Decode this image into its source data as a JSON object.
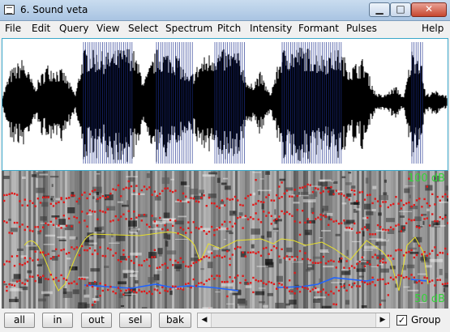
{
  "window": {
    "title": "6. Sound veta",
    "minimize_symbol": "▁",
    "maximize_symbol": "□",
    "close_symbol": "✕"
  },
  "menu": [
    "File",
    "Edit",
    "Query",
    "View",
    "Select",
    "Spectrum",
    "Pitch",
    "Intensity",
    "Formant",
    "Pulses",
    "Help"
  ],
  "spectrogram": {
    "top_label": "100 dB",
    "bottom_label": "50 dB",
    "colors": {
      "formant": "#e11a1a",
      "pitch": "#1f64ff",
      "intensity": "#e8e02a"
    }
  },
  "toolbar": {
    "buttons": [
      "all",
      "in",
      "out",
      "sel",
      "bak"
    ],
    "scroll_left": "◀",
    "scroll_right": "▶",
    "group_label": "Group",
    "group_checked": true,
    "check_mark": "✓"
  },
  "waveform_colors": {
    "signal": "#000000",
    "pulses": "#1c2f8f"
  }
}
